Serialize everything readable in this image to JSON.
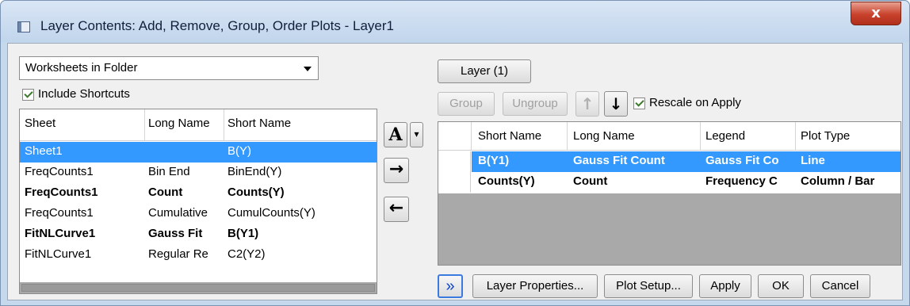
{
  "window": {
    "title": "Layer Contents: Add, Remove, Group, Order Plots - Layer1",
    "close_label": "x"
  },
  "left": {
    "source_combo": "Worksheets in Folder",
    "include_shortcuts": "Include Shortcuts",
    "columns": [
      "Sheet",
      "Long Name",
      "Short Name"
    ],
    "rows": [
      {
        "sheet": "Sheet1",
        "long": "",
        "short": "B(Y)",
        "selected": true,
        "bold": false
      },
      {
        "sheet": "FreqCounts1",
        "long": "Bin End",
        "short": "BinEnd(Y)",
        "selected": false,
        "bold": false
      },
      {
        "sheet": "FreqCounts1",
        "long": "Count",
        "short": "Counts(Y)",
        "selected": false,
        "bold": true
      },
      {
        "sheet": "FreqCounts1",
        "long": "Cumulative",
        "short": "CumulCounts(Y)",
        "selected": false,
        "bold": false
      },
      {
        "sheet": "FitNLCurve1",
        "long": "Gauss Fit",
        "short": "B(Y1)",
        "selected": false,
        "bold": true
      },
      {
        "sheet": "FitNLCurve1",
        "long": "Regular Re",
        "short": "C2(Y2)",
        "selected": false,
        "bold": false
      }
    ]
  },
  "middle": {
    "a_button": "A",
    "a_dropdown": "▾",
    "add_arrow": "→",
    "remove_arrow": "←"
  },
  "right": {
    "layer_button": "Layer (1)",
    "group_label": "Group",
    "ungroup_label": "Ungroup",
    "up_arrow": "↑",
    "down_arrow": "↓",
    "rescale_label": "Rescale on Apply",
    "columns": [
      "Short Name",
      "Long Name",
      "Legend",
      "Plot Type"
    ],
    "rows": [
      {
        "short": "B(Y1)",
        "long": "Gauss Fit Count",
        "legend": "Gauss Fit Co",
        "type": "Line",
        "selected": true
      },
      {
        "short": "Counts(Y)",
        "long": "Count",
        "legend": "Frequency C",
        "type": "Column / Bar",
        "selected": false
      }
    ]
  },
  "footer": {
    "expand": "»",
    "layer_properties": "Layer Properties...",
    "plot_setup": "Plot Setup...",
    "apply": "Apply",
    "ok": "OK",
    "cancel": "Cancel"
  }
}
